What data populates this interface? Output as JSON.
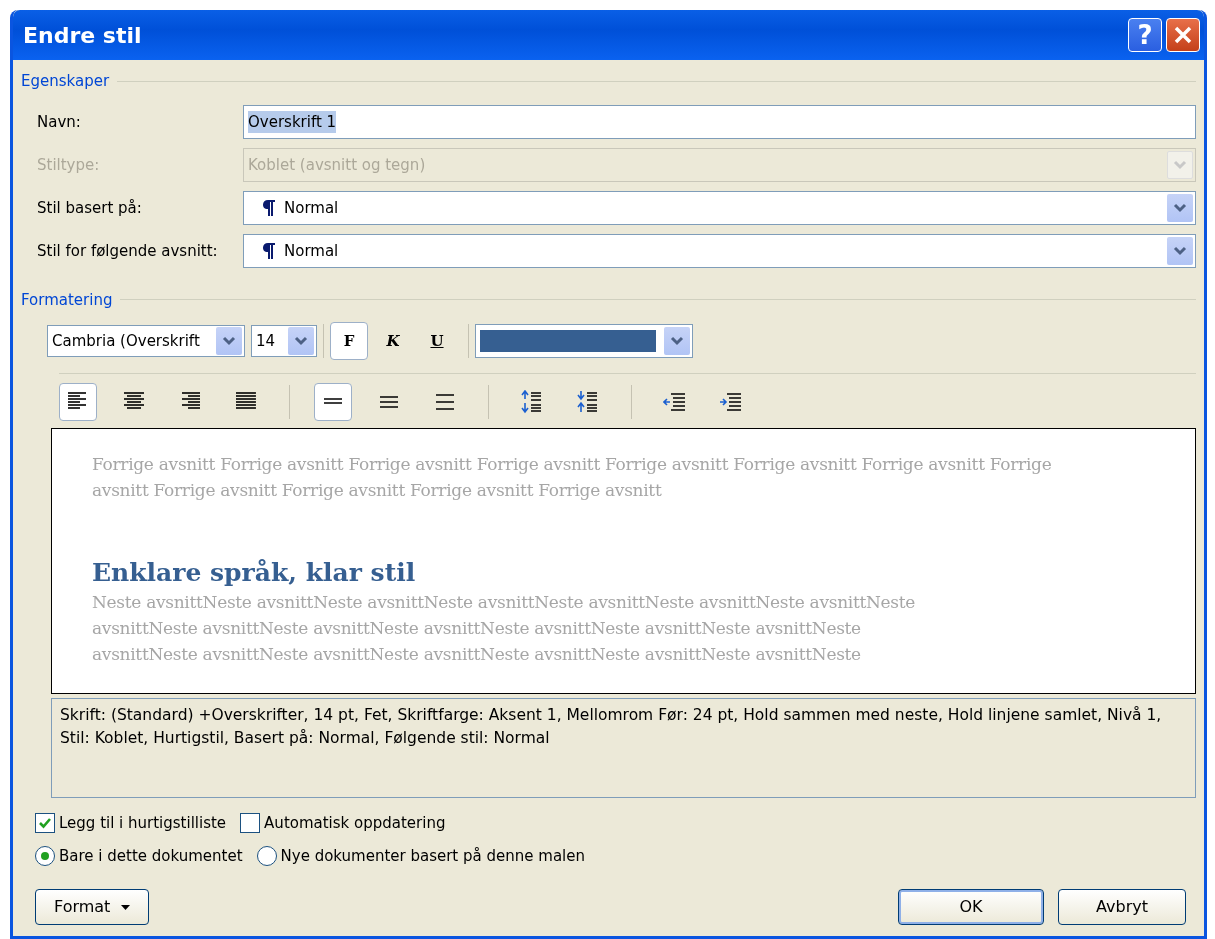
{
  "window": {
    "title": "Endre stil"
  },
  "title_buttons": [
    {
      "kind": "help",
      "label": "?"
    },
    {
      "kind": "close"
    }
  ],
  "properties": {
    "heading": "Egenskaper",
    "fields": [
      {
        "kind": "text",
        "label": "Navn:",
        "value": "Overskrift 1",
        "selected": true,
        "disabled": false
      },
      {
        "kind": "select",
        "label": "Stiltype:",
        "value": "Koblet (avsnitt og tegn)",
        "disabled": true,
        "pilcrow": false
      },
      {
        "kind": "select",
        "label": "Stil basert på:",
        "value": "Normal",
        "disabled": false,
        "pilcrow": true
      },
      {
        "kind": "select",
        "label": "Stil for følgende avsnitt:",
        "value": "Normal",
        "disabled": false,
        "pilcrow": true
      }
    ]
  },
  "formatting": {
    "heading": "Formatering",
    "font": "Cambria (Overskrift",
    "size": "14",
    "styles": [
      {
        "kind": "bold",
        "label": "F",
        "selected": true
      },
      {
        "kind": "italic",
        "label": "K",
        "selected": false
      },
      {
        "kind": "underline",
        "label": "U",
        "selected": false
      }
    ],
    "paragraph_buttons": [
      {
        "kind": "align-left",
        "selected": true
      },
      {
        "kind": "align-center",
        "selected": false
      },
      {
        "kind": "align-right",
        "selected": false
      },
      {
        "kind": "justify",
        "selected": false
      },
      {
        "kind": "single-spacing",
        "selected": true
      },
      {
        "kind": "one-half-spacing",
        "selected": false
      },
      {
        "kind": "double-spacing",
        "selected": false
      },
      {
        "kind": "space-before",
        "selected": false
      },
      {
        "kind": "space-after",
        "selected": false
      },
      {
        "kind": "indent-decrease",
        "selected": false
      },
      {
        "kind": "indent-increase",
        "selected": false
      }
    ]
  },
  "preview": {
    "previous_lines": [
      "Forrige avsnitt Forrige avsnitt Forrige avsnitt Forrige avsnitt Forrige avsnitt Forrige avsnitt Forrige avsnitt Forrige",
      "avsnitt Forrige avsnitt Forrige avsnitt Forrige avsnitt Forrige avsnitt"
    ],
    "heading": "Enklare språk, klar stil",
    "next_lines": [
      "Neste avsnittNeste avsnittNeste avsnittNeste avsnittNeste avsnittNeste avsnittNeste avsnittNeste",
      "avsnittNeste avsnittNeste avsnittNeste avsnittNeste avsnittNeste avsnittNeste avsnittNeste",
      "avsnittNeste avsnittNeste avsnittNeste avsnittNeste avsnittNeste avsnittNeste avsnittNeste"
    ]
  },
  "description": "Skrift: (Standard) +Overskrifter, 14 pt, Fet, Skriftfarge: Aksent 1, Mellomrom Før:  24 pt, Hold sammen med neste, Hold linjene samlet, Nivå 1, Stil: Koblet, Hurtigstil, Basert på: Normal, Følgende stil: Normal",
  "checkboxes": [
    {
      "label": "Legg til i hurtigstilliste",
      "checked": true
    },
    {
      "label": "Automatisk oppdatering",
      "checked": false
    }
  ],
  "radios": [
    {
      "label": "Bare i dette dokumentet",
      "selected": true
    },
    {
      "label": "Nye dokumenter basert på denne malen",
      "selected": false
    }
  ],
  "buttons": [
    {
      "kind": "menu",
      "label": "Format"
    },
    {
      "kind": "default",
      "label": "OK"
    },
    {
      "kind": "normal",
      "label": "Avbryt"
    }
  ]
}
